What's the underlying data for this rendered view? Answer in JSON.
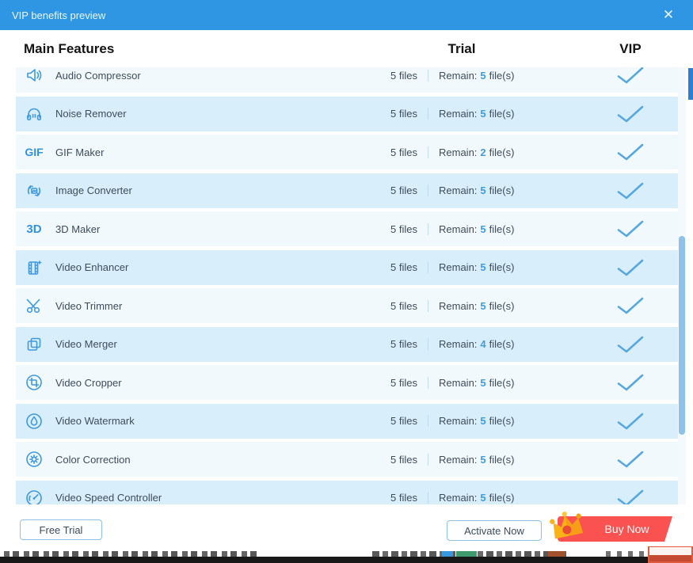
{
  "dialog": {
    "title": "VIP benefits preview",
    "close_glyph": "✕"
  },
  "header": {
    "features": "Main Features",
    "trial": "Trial",
    "vip": "VIP"
  },
  "rows": [
    {
      "icon": "audio-compressor-icon",
      "label": "Audio Compressor",
      "files": "5 files",
      "remain_label": "Remain:",
      "remain_count": "5",
      "remain_unit": "file(s)",
      "vip": true
    },
    {
      "icon": "noise-remover-icon",
      "label": "Noise Remover",
      "files": "5 files",
      "remain_label": "Remain:",
      "remain_count": "5",
      "remain_unit": "file(s)",
      "vip": true
    },
    {
      "icon": "gif-maker-icon",
      "label": "GIF Maker",
      "files": "5 files",
      "remain_label": "Remain:",
      "remain_count": "2",
      "remain_unit": "file(s)",
      "vip": true
    },
    {
      "icon": "image-converter-icon",
      "label": "Image Converter",
      "files": "5 files",
      "remain_label": "Remain:",
      "remain_count": "5",
      "remain_unit": "file(s)",
      "vip": true
    },
    {
      "icon": "3d-maker-icon",
      "label": "3D Maker",
      "files": "5 files",
      "remain_label": "Remain:",
      "remain_count": "5",
      "remain_unit": "file(s)",
      "vip": true
    },
    {
      "icon": "video-enhancer-icon",
      "label": "Video Enhancer",
      "files": "5 files",
      "remain_label": "Remain:",
      "remain_count": "5",
      "remain_unit": "file(s)",
      "vip": true
    },
    {
      "icon": "video-trimmer-icon",
      "label": "Video Trimmer",
      "files": "5 files",
      "remain_label": "Remain:",
      "remain_count": "5",
      "remain_unit": "file(s)",
      "vip": true
    },
    {
      "icon": "video-merger-icon",
      "label": "Video Merger",
      "files": "5 files",
      "remain_label": "Remain:",
      "remain_count": "4",
      "remain_unit": "file(s)",
      "vip": true
    },
    {
      "icon": "video-cropper-icon",
      "label": "Video Cropper",
      "files": "5 files",
      "remain_label": "Remain:",
      "remain_count": "5",
      "remain_unit": "file(s)",
      "vip": true
    },
    {
      "icon": "video-watermark-icon",
      "label": "Video Watermark",
      "files": "5 files",
      "remain_label": "Remain:",
      "remain_count": "5",
      "remain_unit": "file(s)",
      "vip": true
    },
    {
      "icon": "color-correction-icon",
      "label": "Color Correction",
      "files": "5 files",
      "remain_label": "Remain:",
      "remain_count": "5",
      "remain_unit": "file(s)",
      "vip": true
    },
    {
      "icon": "video-speed-controller-icon",
      "label": "Video Speed Controller",
      "files": "5 files",
      "remain_label": "Remain:",
      "remain_count": "5",
      "remain_unit": "file(s)",
      "vip": true
    }
  ],
  "footer": {
    "free_trial": "Free Trial",
    "activate_now": "Activate Now",
    "buy_now": "Buy Now"
  },
  "colors": {
    "titlebar_blue": "#2f96e3",
    "accent_blue": "#3b97dd",
    "row_blue": "#d9eefb",
    "row_light": "#f2f9fd",
    "checkmark_blue": "#57a8e0",
    "buy_now_red": "#fa5151",
    "crown_gold": "#fbb216",
    "crown_center_red": "#e94b35",
    "scrollbar_thumb": "#8fc2e9"
  }
}
